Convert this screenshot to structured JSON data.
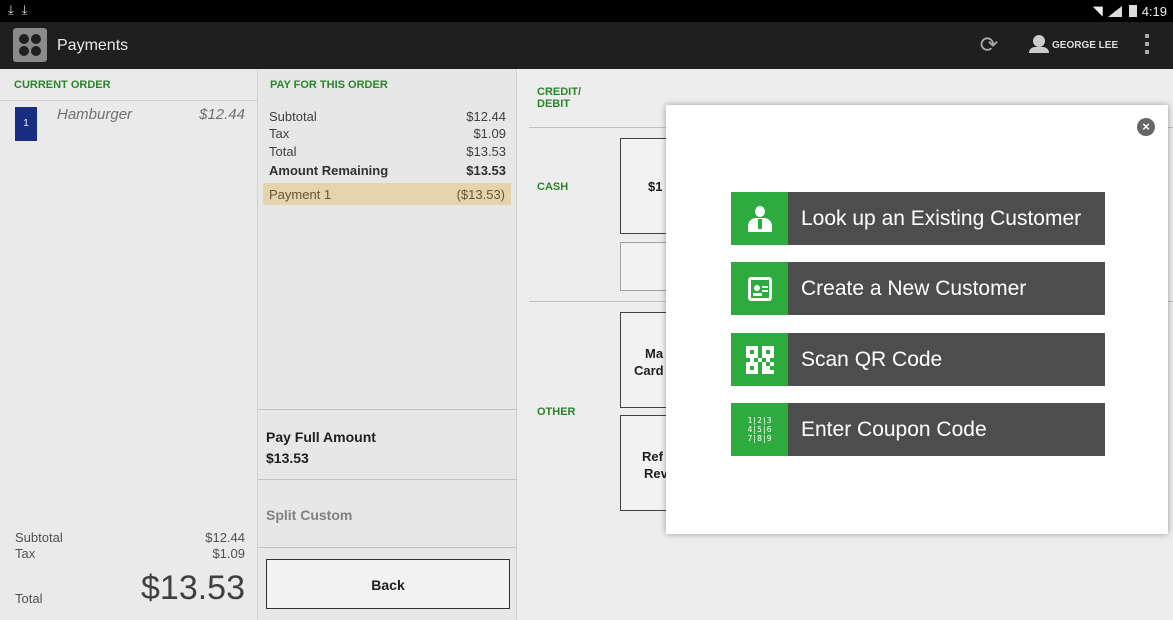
{
  "status_bar": {
    "time": "4:19",
    "left_icons": [
      "download-icon",
      "download-icon"
    ]
  },
  "app_bar": {
    "title": "Payments",
    "user_name": "GEORGE LEE"
  },
  "current_order": {
    "heading": "CURRENT ORDER",
    "items": [
      {
        "qty": "1",
        "name": "Hamburger",
        "price": "$12.44"
      }
    ],
    "subtotal_label": "Subtotal",
    "subtotal": "$12.44",
    "tax_label": "Tax",
    "tax": "$1.09",
    "total_label": "Total",
    "total": "$13.53"
  },
  "pay_order": {
    "heading": "PAY FOR THIS ORDER",
    "subtotal_label": "Subtotal",
    "subtotal": "$12.44",
    "tax_label": "Tax",
    "tax": "$1.09",
    "total_label": "Total",
    "total": "$13.53",
    "remaining_label": "Amount Remaining",
    "remaining": "$13.53",
    "payment_label": "Payment 1",
    "payment": "($13.53)",
    "pay_full_label": "Pay Full Amount",
    "pay_full_amount": "$13.53",
    "split_label": "Split Custom",
    "back_label": "Back"
  },
  "methods": {
    "credit_heading_line1": "CREDIT/",
    "credit_heading_line2": "DEBIT",
    "cash_heading": "CASH",
    "cash_button": "$1",
    "other_heading": "OTHER",
    "other_btn1_line1": "Ma",
    "other_btn1_line2": "Card",
    "other_btn2_line1": "Ref",
    "other_btn2_line2": "Rev"
  },
  "dialog": {
    "options": [
      {
        "label": "Look up an Existing Customer",
        "icon": "customer-lookup-icon"
      },
      {
        "label": "Create a New Customer",
        "icon": "contact-card-icon"
      },
      {
        "label": "Scan QR Code",
        "icon": "qr-code-icon"
      },
      {
        "label": "Enter Coupon Code",
        "icon": "number-pad-icon"
      }
    ],
    "number_pad_digits": [
      "1|2|3",
      "4|5|6",
      "7|8|9"
    ],
    "colors": {
      "icon_bg": "#2eab3f",
      "button_bg": "#4d4d4d"
    }
  }
}
